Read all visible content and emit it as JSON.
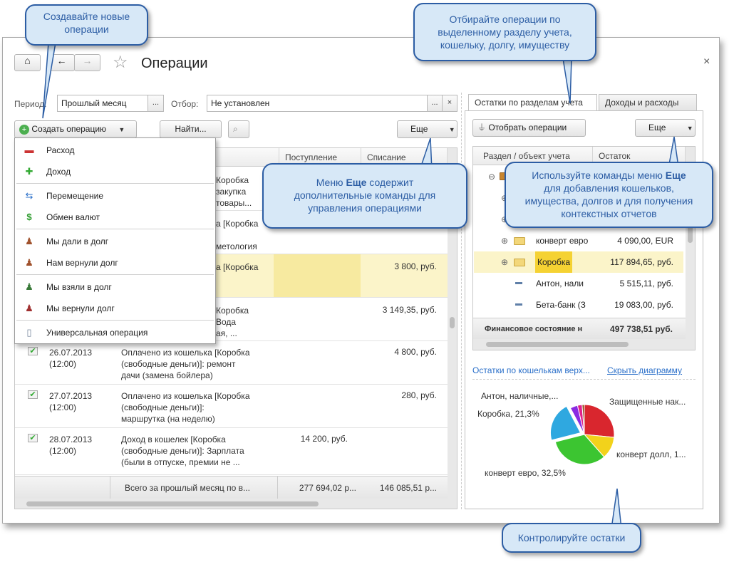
{
  "window": {
    "title": "Операции",
    "close": "×"
  },
  "nav": {
    "home": "⌂",
    "back": "←",
    "forward": "→",
    "star": "☆"
  },
  "filters": {
    "period_label": "Период:",
    "period_value": "Прошлый месяц",
    "period_btn": "...",
    "selection_label": "Отбор:",
    "selection_value": "Не установлен",
    "selection_btn": "...",
    "selection_clear": "×"
  },
  "toolbar": {
    "create": "Создать операцию",
    "find": "Найти...",
    "more": "Еще"
  },
  "table": {
    "columns": [
      "Поступление",
      "Списание"
    ],
    "rows": [
      {
        "date": "",
        "text": "Коробка\nзакупка\nтовары...",
        "in": "",
        "out": ""
      },
      {
        "date": "",
        "text": "а [Коробка\n\nметология",
        "in": "",
        "out": ""
      },
      {
        "date": "",
        "text": "а [Коробка",
        "in": "",
        "out": "3 800, руб."
      },
      {
        "date": "",
        "text": "Коробка\nВода\nая, ...",
        "in": "",
        "out": "3 149,35, руб."
      },
      {
        "date": "26.07.2013\n(12:00)",
        "text": "Оплачено из кошелька [Коробка\n(свободные деньги)]: ремонт\nдачи (замена бойлера)",
        "in": "",
        "out": "4 800, руб."
      },
      {
        "date": "27.07.2013\n(12:00)",
        "text": "Оплачено из кошелька [Коробка\n(свободные деньги)]:\nмаршрутка (на неделю)",
        "in": "",
        "out": "280, руб."
      },
      {
        "date": "28.07.2013\n(12:00)",
        "text": "Доход в кошелек [Коробка\n(свободные деньги)]: Зарплата\n(были в отпуске, премии не ...",
        "in": "14 200, руб.",
        "out": ""
      }
    ],
    "total_label": "Всего за прошлый месяц по в...",
    "total_in": "277 694,02 р...",
    "total_out": "146 085,51 р..."
  },
  "menu": {
    "items": [
      {
        "label": "Расход",
        "icon": "expense-icon"
      },
      {
        "label": "Доход",
        "icon": "income-icon"
      },
      {
        "label": "Перемещение",
        "icon": "transfer-icon"
      },
      {
        "label": "Обмен валют",
        "icon": "currency-exchange-icon"
      },
      {
        "label": "Мы дали в долг",
        "icon": "lend-icon"
      },
      {
        "label": "Нам вернули долг",
        "icon": "debt-returned-to-us-icon"
      },
      {
        "label": "Мы взяли в долг",
        "icon": "borrow-icon"
      },
      {
        "label": "Мы вернули долг",
        "icon": "debt-repaid-icon"
      },
      {
        "label": "Универсальная операция",
        "icon": "document-icon"
      }
    ]
  },
  "right": {
    "tabs": [
      "Остатки по разделам учета",
      "Доходы и расходы"
    ],
    "filter_btn": "Отобрать операции",
    "more": "Еще",
    "columns": [
      "Раздел / объект учета",
      "Остаток"
    ],
    "rows": [
      {
        "name": "",
        "value": ""
      },
      {
        "name": "",
        "value": ""
      },
      {
        "name": "",
        "value": ""
      },
      {
        "name": "конверт евро",
        "value": "4 090,00, EUR"
      },
      {
        "name": "Коробка",
        "value": "117 894,65, руб."
      },
      {
        "name": "Антон, нали",
        "value": "5 515,11, руб."
      },
      {
        "name": "Бета-банк (З",
        "value": "19 083,00, руб."
      }
    ],
    "total_label": "Финансовое состояние н",
    "total_value": "497 738,51 руб.",
    "chart_title": "Остатки по кошелькам верх...",
    "hide_chart": "Скрыть диаграмму"
  },
  "chart_data": {
    "type": "pie",
    "title": "Остатки по кошелькам верх...",
    "slices": [
      {
        "label": "Защищенные нак...",
        "value": 26.5,
        "color": "#d9262e"
      },
      {
        "label": "конверт долл, 1...",
        "value": 12.0,
        "color": "#f2d21b"
      },
      {
        "label": "конверт евро, 32,5%",
        "value": 32.5,
        "color": "#3cc531"
      },
      {
        "label": "Коробка, 21,3%",
        "value": 21.3,
        "color": "#2fa8e0"
      },
      {
        "label": "Антон, наличные,...",
        "value": 4.0,
        "color": "#8a2be2"
      },
      {
        "label": "",
        "value": 2.5,
        "color": "#e0218a"
      },
      {
        "label": "",
        "value": 1.2,
        "color": "#8b4513"
      }
    ]
  },
  "callouts": {
    "create": "Создавайте новые\nоперации",
    "filter": "Отбирайте операции по\nвыделенному разделу учета,\nкошельку, долгу, имуществу",
    "more_prefix": "Меню ",
    "more_bold": "Еще",
    "more_suffix": " содержит\nдополнительные команды для\nуправления операциями",
    "right_more_prefix": "Используйте команды меню ",
    "right_more_bold": "Еще",
    "right_more_suffix": "\nдля добавления кошельков,\nимущества, долгов и для получения\nконтекстных отчетов",
    "balances": "Контролируйте остатки"
  }
}
